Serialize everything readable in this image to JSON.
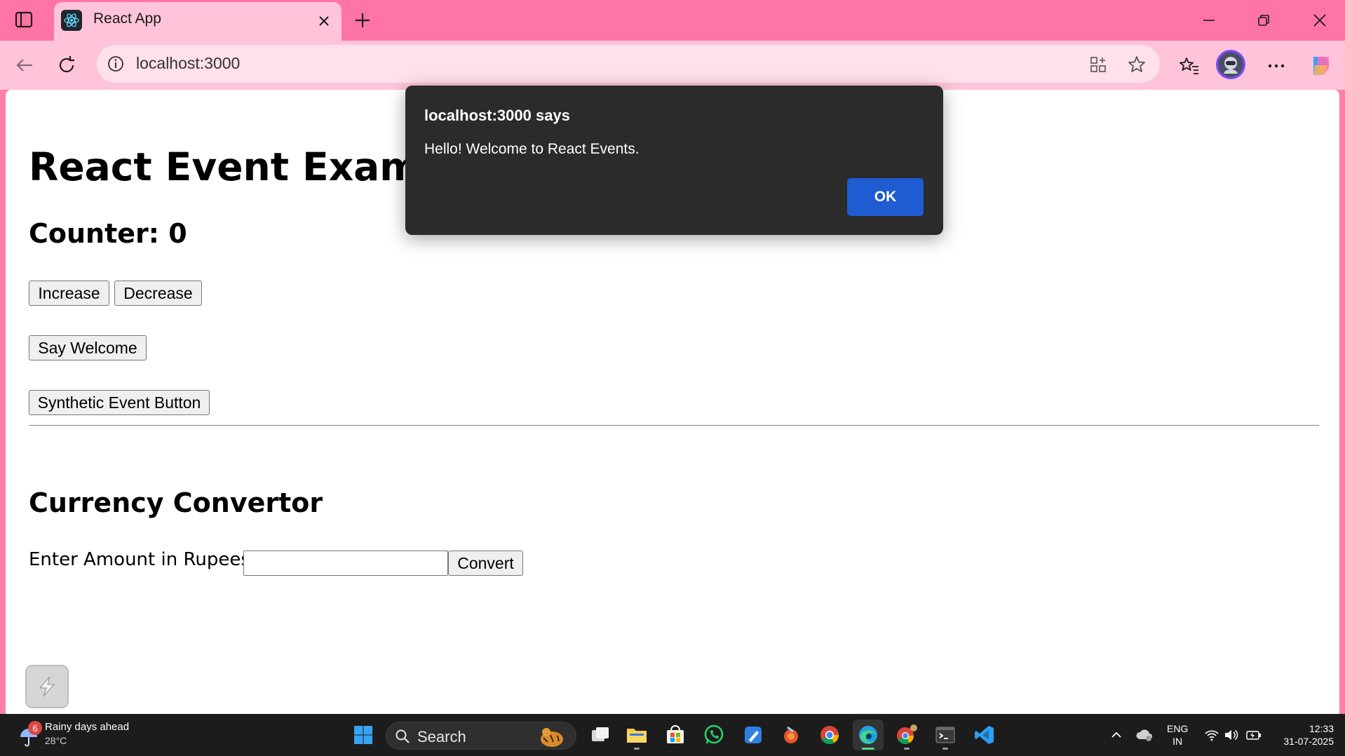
{
  "browser": {
    "tab_title": "React App",
    "url": "localhost:3000"
  },
  "page": {
    "heading": "React Event Examples",
    "counter_label": "Counter: 0",
    "buttons": {
      "increase": "Increase",
      "decrease": "Decrease",
      "say_welcome": "Say Welcome",
      "synthetic": "Synthetic Event Button",
      "convert": "Convert"
    },
    "currency_heading": "Currency Convertor",
    "amount_label": "Enter Amount in Rupees:",
    "amount_value": ""
  },
  "dialog": {
    "title": "localhost:3000 says",
    "message": "Hello! Welcome to React Events.",
    "ok_label": "OK"
  },
  "taskbar": {
    "weather_text": "Rainy days ahead",
    "weather_temp": "28°C",
    "weather_badge": "6",
    "search_label": "Search",
    "lang_top": "ENG",
    "lang_bottom": "IN",
    "time": "12:33",
    "date": "31-07-2025"
  },
  "colors": {
    "tabbar": "#ff74a6",
    "toolbar": "#ffc4d9",
    "dialog_bg": "#2b2b2b",
    "ok_button": "#1f5bd1"
  }
}
